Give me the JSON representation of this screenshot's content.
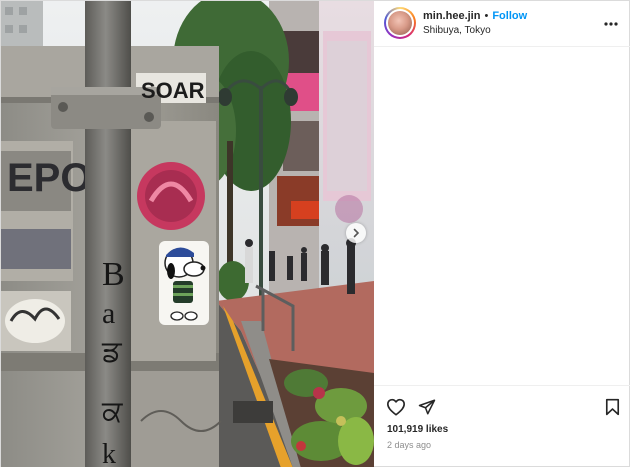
{
  "post": {
    "username": "min.hee.jin",
    "separator": "•",
    "follow_label": "Follow",
    "location": "Shibuya, Tokyo",
    "likes": "101,919 likes",
    "timestamp": "2 days ago"
  },
  "photo": {
    "sign_text": "SOAR"
  },
  "icons": {
    "more": "more-options-icon",
    "like": "heart-icon",
    "share": "send-icon",
    "save": "bookmark-icon",
    "next": "chevron-right-icon"
  },
  "colors": {
    "follow": "#0095f6",
    "text": "#262626",
    "muted": "#8e8e8e"
  }
}
